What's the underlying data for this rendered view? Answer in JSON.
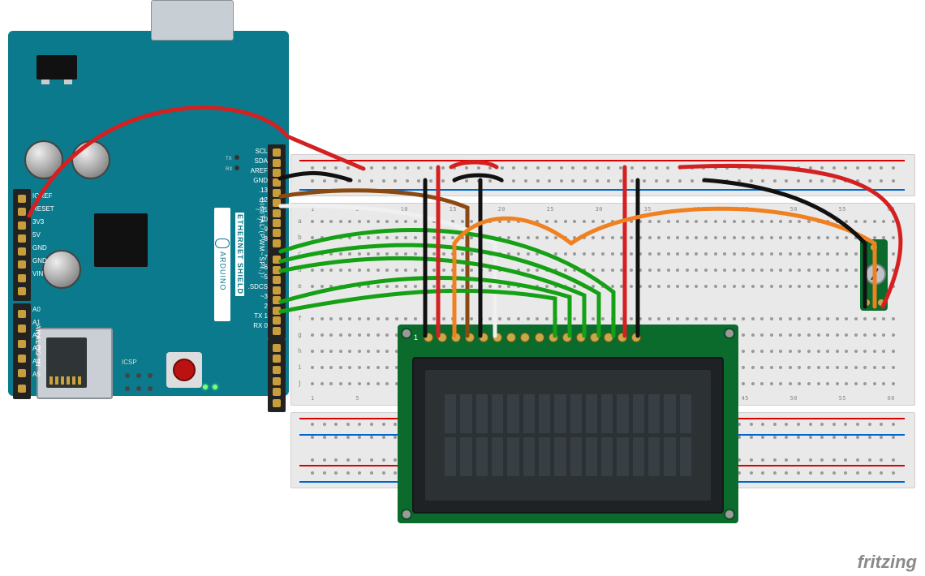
{
  "watermark": "fritzing",
  "components": {
    "shield": {
      "brand": "ARDUINO",
      "model": "ETHERNET SHIELD",
      "digital_label": "DIGITAL (PWM~SPI.)",
      "analog_label": "ANALOG IN",
      "icsp_label": "ICSP",
      "tx_label": "TX",
      "rx_label": "RX",
      "pins_right_top": [
        "SCL",
        "SDA",
        "AREF",
        "GND",
        ".13",
        ".12",
        "~.11",
        "~10",
        "~9",
        "8"
      ],
      "pins_right_mid": [
        "7",
        "~6",
        "~5",
        ".SDCS",
        "~3",
        "2",
        "TX 1",
        "RX 0"
      ],
      "pins_left_top": [
        "IOREF",
        "RESET",
        "3V3",
        "5V",
        "GND",
        "GND",
        "VIN"
      ],
      "pins_left_bottom": [
        "A0",
        "A1",
        "A2",
        "A3",
        "A4",
        "A5"
      ]
    },
    "lcd": {
      "pin1_label": "1",
      "cols": 16,
      "rows": 2,
      "pin_count": 16
    },
    "breadboard": {
      "columns": 63,
      "column_labels_shown": [
        "1",
        "5",
        "10",
        "15",
        "20",
        "25",
        "30",
        "35",
        "40",
        "45",
        "50",
        "55",
        "60"
      ],
      "row_labels_top": [
        "a",
        "b",
        "c",
        "d",
        "e"
      ],
      "row_labels_bottom": [
        "f",
        "g",
        "h",
        "i",
        "j"
      ]
    },
    "trimpot": {
      "name": "Trim Potentiometer"
    }
  },
  "wiring": [
    {
      "net": "5V",
      "from": "shield.5V",
      "to": "breadboard.top_rail_red",
      "color": "#d42020"
    },
    {
      "net": "GND",
      "from": "shield.GND",
      "to": "breadboard.top_rail_blue",
      "color": "#111111"
    },
    {
      "net": "5V",
      "from": "breadboard.top_rail_red",
      "to": "lcd.pin2_VDD",
      "color": "#d42020"
    },
    {
      "net": "GND",
      "from": "breadboard.top_rail_blue",
      "to": "lcd.pin1_VSS",
      "color": "#111111"
    },
    {
      "net": "5V",
      "from": "breadboard.top_rail_red",
      "to": "lcd.pin15_A",
      "color": "#d42020"
    },
    {
      "net": "GND",
      "from": "breadboard.top_rail_blue",
      "to": "lcd.pin16_K",
      "color": "#111111"
    },
    {
      "net": "GND",
      "from": "breadboard.top_rail_blue",
      "to": "lcd.pin5_RW",
      "color": "#111111"
    },
    {
      "net": "RS",
      "from": "shield.D12",
      "to": "lcd.pin4_RS",
      "color": "#8a4a12"
    },
    {
      "net": "E",
      "from": "shield.D11",
      "to": "lcd.pin6_E",
      "color": "#f0f0f0"
    },
    {
      "net": "D4",
      "from": "shield.D5",
      "to": "lcd.pin11_D4",
      "color": "#15a015"
    },
    {
      "net": "D5",
      "from": "shield.D3",
      "to": "lcd.pin12_D5",
      "color": "#15a015"
    },
    {
      "net": "D6",
      "from": "shield.D2",
      "to": "lcd.pin13_D6",
      "color": "#15a015"
    },
    {
      "net": "D7",
      "from": "shield.D7",
      "to": "lcd.pin14_D7",
      "color": "#15a015"
    },
    {
      "net": "D4a",
      "from": "shield.D6",
      "to": "breadboard",
      "color": "#15a015"
    },
    {
      "net": "VO",
      "from": "trimpot.wiper",
      "to": "lcd.pin3_VO",
      "color": "#f08020"
    },
    {
      "net": "5V",
      "from": "breadboard.top_rail_red",
      "to": "trimpot.A",
      "color": "#d42020"
    },
    {
      "net": "GND",
      "from": "breadboard.top_rail_blue",
      "to": "trimpot.B",
      "color": "#111111"
    },
    {
      "net": "VO2",
      "from": "trimpot",
      "to": "breadboard",
      "color": "#f08020"
    }
  ],
  "wire_colors": {
    "red": "#d42020",
    "black": "#111111",
    "brown": "#8a4a12",
    "white": "#f0f0f0",
    "green": "#15a015",
    "orange": "#f08020"
  }
}
